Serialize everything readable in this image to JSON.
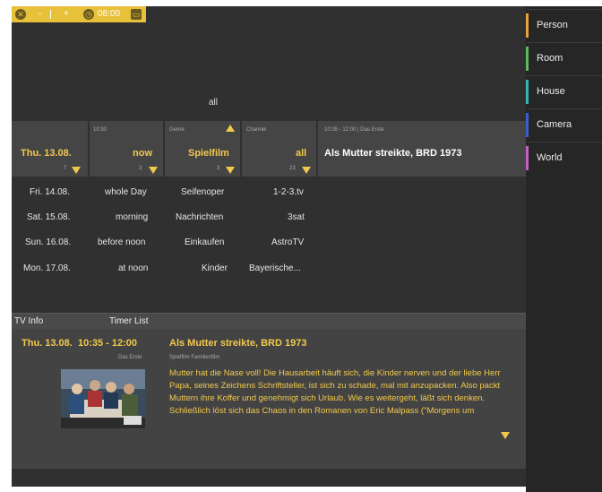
{
  "topbar": {
    "minus": "-",
    "plus": "+",
    "time": "08:00"
  },
  "filter": {
    "all_label": "all",
    "date": {
      "value": "Thu. 13.08.",
      "count": "7"
    },
    "time": {
      "header": "10:30",
      "value": "now",
      "count": "3"
    },
    "genre": {
      "header": "Genre",
      "value": "Spielfilm",
      "count": "3"
    },
    "channel": {
      "header": "Channel",
      "value": "all",
      "count": "23"
    },
    "program": {
      "header": "10:35 - 12:00 | Das Erste",
      "value": "Als Mutter streikte, BRD 1973"
    }
  },
  "options": {
    "dates": [
      "Fri. 14.08.",
      "Sat. 15.08.",
      "Sun. 16.08.",
      "Mon. 17.08."
    ],
    "times": [
      "whole Day",
      "morning",
      "before noon",
      "at noon"
    ],
    "genres": [
      "Seifenoper",
      "Nachrichten",
      "Einkaufen",
      "Kinder"
    ],
    "channels": [
      "1-2-3.tv",
      "3sat",
      "AstroTV",
      "Bayerische..."
    ]
  },
  "tabs": {
    "tv_info": "TV Info",
    "timer_list": "Timer List"
  },
  "info": {
    "date_time": "Thu. 13.08.  10:35 - 12:00",
    "channel": "Das Erste",
    "title": "Als Mutter streikte, BRD 1973",
    "subgenre": "Spielfilm Familienfilm",
    "description": "Mutter hat die Nase voll! Die Hausarbeit häuft sich, die Kinder nerven und der liebe Herr Papa, seines Zeichens Schriftsteller, ist sich zu schade, mal mit anzupacken. Also packt Muttern ihre Koffer und genehmigt sich Urlaub.  Wie es weitergeht, läßt sich denken. Schließlich löst sich das Chaos in den Romanen von Eric Malpass (\"Morgens um"
  },
  "sidebar": [
    {
      "label": "Person",
      "color": "#e8a23a"
    },
    {
      "label": "Room",
      "color": "#5dbb5d"
    },
    {
      "label": "House",
      "color": "#2fb7b0"
    },
    {
      "label": "Camera",
      "color": "#3a5fcd"
    },
    {
      "label": "World",
      "color": "#c45ec8"
    }
  ]
}
